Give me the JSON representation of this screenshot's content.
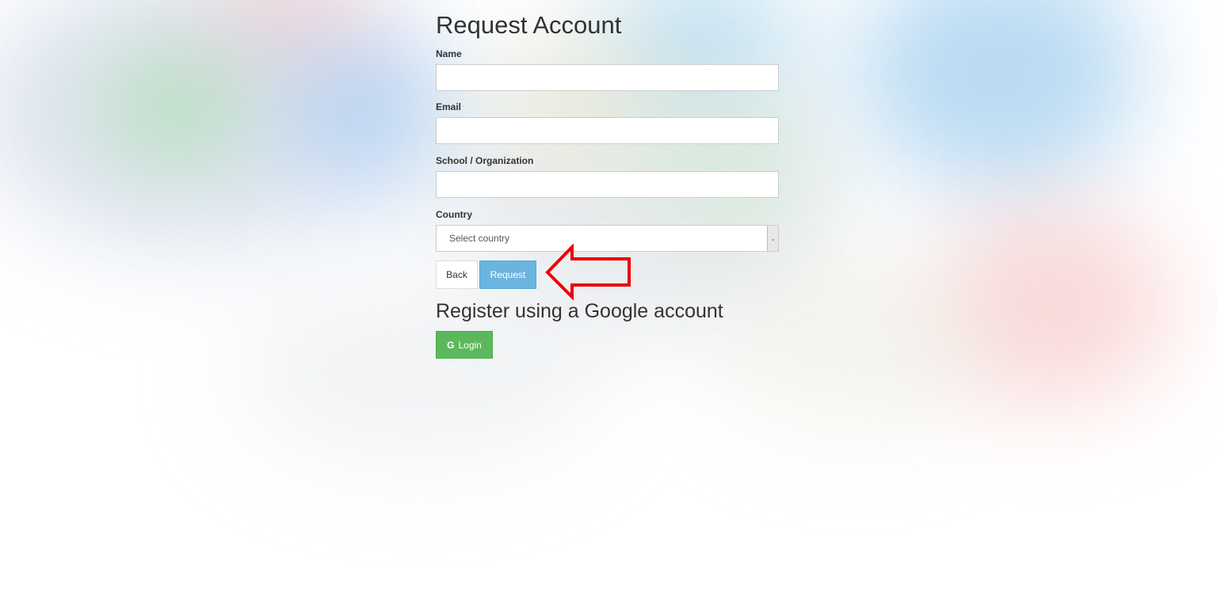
{
  "form": {
    "title": "Request Account",
    "fields": {
      "name": {
        "label": "Name",
        "value": "",
        "placeholder": ""
      },
      "email": {
        "label": "Email",
        "value": "",
        "placeholder": ""
      },
      "organization": {
        "label": "School / Organization",
        "value": "",
        "placeholder": ""
      },
      "country": {
        "label": "Country",
        "selected": "Select country"
      }
    },
    "buttons": {
      "back": "Back",
      "request": "Request"
    }
  },
  "google": {
    "title": "Register using a Google account",
    "button_icon": "G",
    "button_label": "Login"
  },
  "annotation": {
    "arrow_color": "#ee0000"
  },
  "colors": {
    "request_button": "#6ab4e0",
    "google_button": "#5cb85c"
  }
}
